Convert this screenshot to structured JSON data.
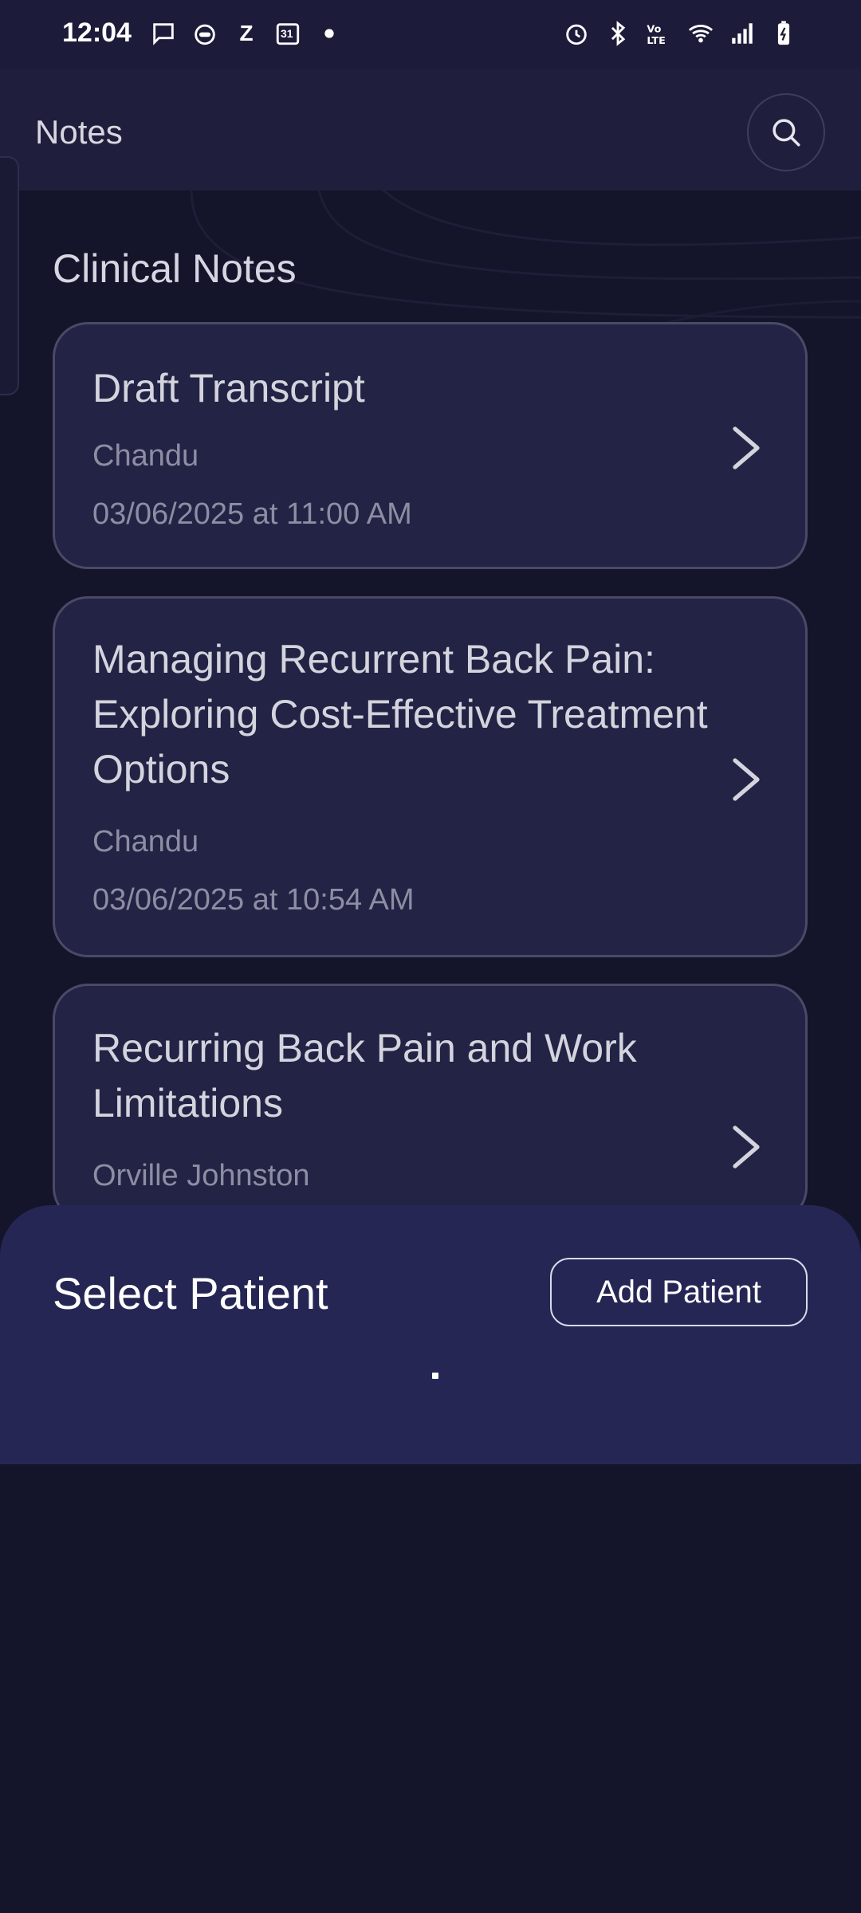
{
  "status_bar": {
    "time": "12:04",
    "left_icons": [
      "message-icon",
      "chatbot-icon",
      "z-icon",
      "calendar-icon",
      "dot-icon"
    ],
    "calendar_day": "31",
    "right_icons": [
      "alarm-icon",
      "bluetooth-icon",
      "volte-icon",
      "wifi-icon",
      "signal-icon",
      "battery-icon"
    ]
  },
  "header": {
    "title": "Notes"
  },
  "section": {
    "title": "Clinical Notes"
  },
  "notes": [
    {
      "title": "Draft Transcript",
      "patient": "Chandu",
      "date": "03/06/2025 at 11:00 AM"
    },
    {
      "title": "Managing Recurrent Back Pain: Exploring Cost-Effective Treatment Options",
      "patient": "Chandu",
      "date": "03/06/2025 at 10:54 AM"
    },
    {
      "title": "Recurring Back Pain and Work Limitations",
      "patient": "Orville Johnston",
      "date": ""
    }
  ],
  "sheet": {
    "title": "Select Patient",
    "add_button": "Add Patient"
  },
  "colors": {
    "background": "#14142a",
    "card": "#232345",
    "sheet": "#262655"
  }
}
